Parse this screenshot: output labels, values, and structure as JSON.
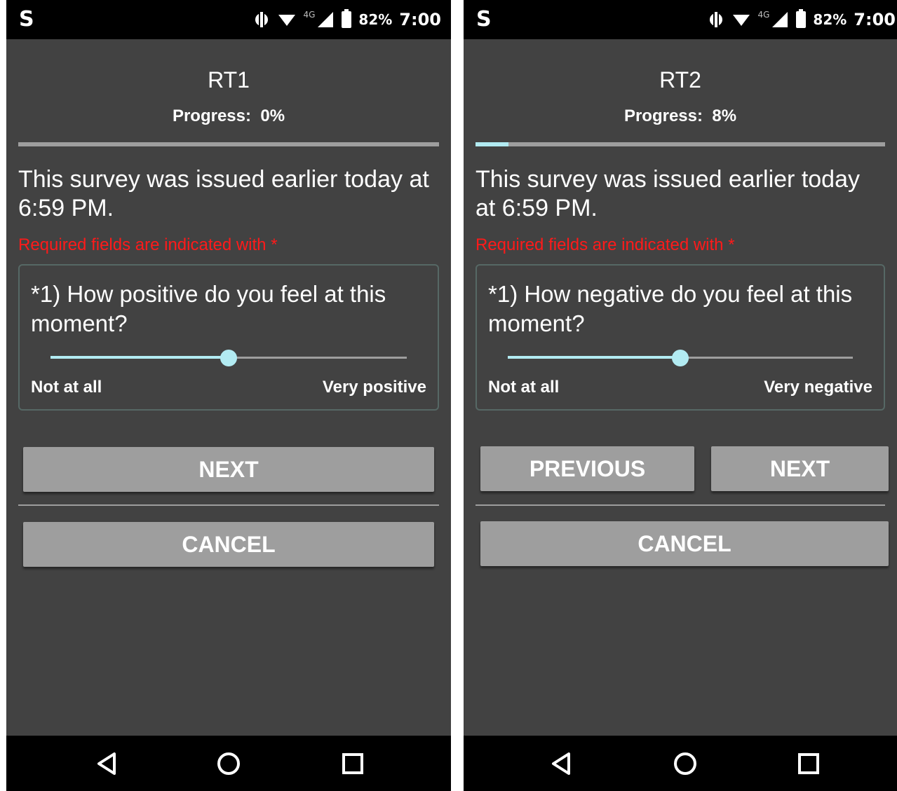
{
  "colors": {
    "background": "#424242",
    "bar": "#000000",
    "accent": "#b2ebf2",
    "button": "#9e9e9e",
    "required": "#ff1a1a",
    "text": "#ffffff"
  },
  "status_bar": {
    "app_letter": "S",
    "network": "4G",
    "battery": "82%",
    "time": "7:00",
    "icons": [
      "sync-icon",
      "wifi-icon",
      "signal-icon",
      "battery-icon"
    ]
  },
  "screens": [
    {
      "title": "RT1",
      "progress_label": "Progress:",
      "progress_value": "0%",
      "progress_fraction": 0.0,
      "issued_text": "This survey was issued earlier today at 6:59 PM.",
      "required_text": "Required fields are indicated with *",
      "question": "*1) How positive do you feel at this moment?",
      "slider": {
        "min_label": "Not at all",
        "max_label": "Very positive",
        "value_fraction": 0.5
      },
      "buttons": {
        "next": "NEXT",
        "cancel": "CANCEL"
      }
    },
    {
      "title": "RT2",
      "progress_label": "Progress:",
      "progress_value": "8%",
      "progress_fraction": 0.08,
      "issued_text": "This survey was issued earlier today at 6:59 PM.",
      "required_text": "Required fields are indicated with *",
      "question": "*1) How negative do you feel at this moment?",
      "slider": {
        "min_label": "Not at all",
        "max_label": "Very negative",
        "value_fraction": 0.5
      },
      "buttons": {
        "previous": "PREVIOUS",
        "next": "NEXT",
        "cancel": "CANCEL"
      }
    }
  ],
  "nav_bar": {
    "icons": [
      "back-icon",
      "home-icon",
      "recents-icon"
    ]
  }
}
